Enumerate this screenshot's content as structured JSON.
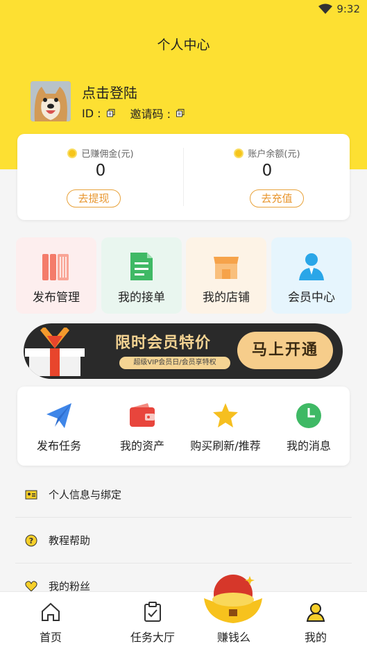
{
  "status": {
    "time": "9:32"
  },
  "header": {
    "title": "个人中心"
  },
  "profile": {
    "login_text": "点击登陆",
    "id_label": "ID :",
    "invite_label": "邀请码 :"
  },
  "wallet": {
    "earned_label": "已赚佣金(元)",
    "earned_value": "0",
    "withdraw_btn": "去提现",
    "balance_label": "账户余额(元)",
    "balance_value": "0",
    "recharge_btn": "去充值"
  },
  "tiles": [
    {
      "label": "发布管理",
      "bg": "#fdeeee",
      "icon": "books-icon"
    },
    {
      "label": "我的接单",
      "bg": "#e9f6ef",
      "icon": "document-icon"
    },
    {
      "label": "我的店铺",
      "bg": "#fdf3e6",
      "icon": "shop-icon"
    },
    {
      "label": "会员中心",
      "bg": "#e6f5fd",
      "icon": "member-icon"
    }
  ],
  "banner": {
    "title": "限时会员特价",
    "subtitle": "超级VIP会员日/会员享特权",
    "button": "马上开通"
  },
  "features": [
    {
      "label": "发布任务",
      "icon": "paper-plane-icon"
    },
    {
      "label": "我的资产",
      "icon": "wallet-icon"
    },
    {
      "label": "购买刷新/推荐",
      "icon": "star-icon"
    },
    {
      "label": "我的消息",
      "icon": "clock-icon"
    }
  ],
  "menu": [
    {
      "label": "个人信息与绑定",
      "icon": "id-card-icon"
    },
    {
      "label": "教程帮助",
      "icon": "help-icon"
    },
    {
      "label": "我的粉丝",
      "icon": "heart-icon"
    }
  ],
  "tabbar": [
    {
      "label": "首页",
      "icon": "home-icon"
    },
    {
      "label": "任务大厅",
      "icon": "clipboard-icon"
    },
    {
      "label": "赚钱么",
      "icon": "gold-ingot-icon"
    },
    {
      "label": "我的",
      "icon": "user-icon"
    }
  ],
  "colors": {
    "brand_yellow": "#fde032",
    "accent_orange": "#e8962e"
  }
}
